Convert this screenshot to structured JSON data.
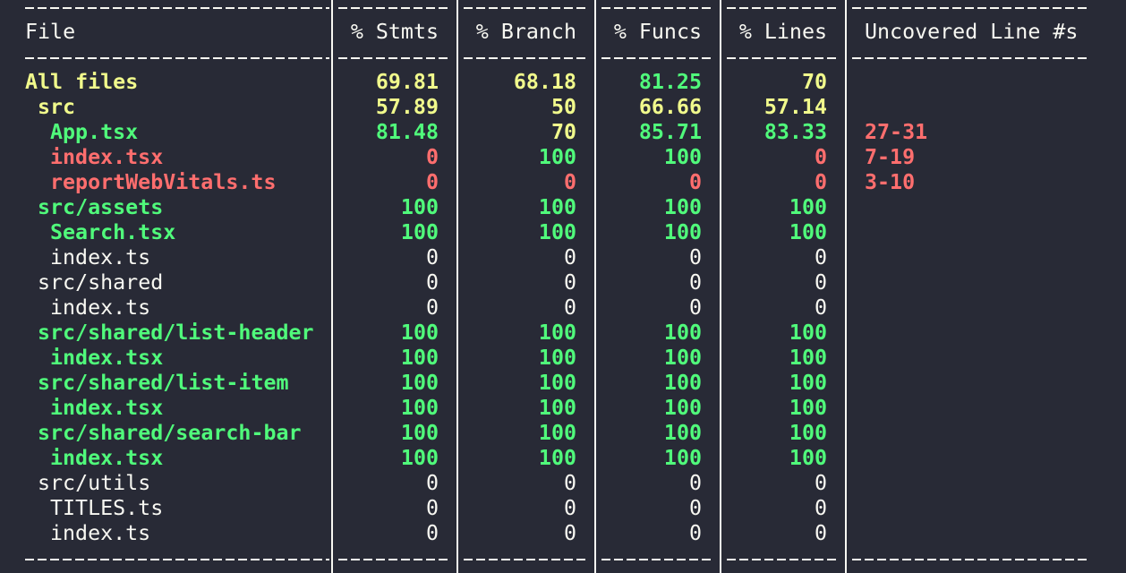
{
  "headers": {
    "file": "File",
    "stmts": "% Stmts",
    "branch": "% Branch",
    "funcs": "% Funcs",
    "lines": "% Lines",
    "uncovered": "Uncovered Line #s"
  },
  "colors": {
    "background": "#282a36",
    "foreground": "#f8f8f2",
    "yellow": "#f1fa8c",
    "green": "#50fa7b",
    "red": "#ff6e6e"
  },
  "rows": [
    {
      "file": "All files",
      "indent": 0,
      "color": "yellow",
      "bold": true,
      "stmts": "69.81",
      "stmts_color": "yellow",
      "branch": "68.18",
      "branch_color": "yellow",
      "funcs": "81.25",
      "funcs_color": "green",
      "lines": "70",
      "lines_color": "yellow",
      "uncovered": ""
    },
    {
      "file": "src",
      "indent": 1,
      "color": "yellow",
      "bold": true,
      "stmts": "57.89",
      "stmts_color": "yellow",
      "branch": "50",
      "branch_color": "yellow",
      "funcs": "66.66",
      "funcs_color": "yellow",
      "lines": "57.14",
      "lines_color": "yellow",
      "uncovered": ""
    },
    {
      "file": "App.tsx",
      "indent": 2,
      "color": "green",
      "bold": true,
      "stmts": "81.48",
      "stmts_color": "green",
      "branch": "70",
      "branch_color": "yellow",
      "funcs": "85.71",
      "funcs_color": "green",
      "lines": "83.33",
      "lines_color": "green",
      "uncovered": "27-31"
    },
    {
      "file": "index.tsx",
      "indent": 2,
      "color": "red",
      "bold": true,
      "stmts": "0",
      "stmts_color": "red",
      "branch": "100",
      "branch_color": "green",
      "funcs": "100",
      "funcs_color": "green",
      "lines": "0",
      "lines_color": "red",
      "uncovered": "7-19"
    },
    {
      "file": "reportWebVitals.ts",
      "indent": 2,
      "color": "red",
      "bold": true,
      "stmts": "0",
      "stmts_color": "red",
      "branch": "0",
      "branch_color": "red",
      "funcs": "0",
      "funcs_color": "red",
      "lines": "0",
      "lines_color": "red",
      "uncovered": "3-10"
    },
    {
      "file": "src/assets",
      "indent": 1,
      "color": "green",
      "bold": true,
      "stmts": "100",
      "stmts_color": "green",
      "branch": "100",
      "branch_color": "green",
      "funcs": "100",
      "funcs_color": "green",
      "lines": "100",
      "lines_color": "green",
      "uncovered": ""
    },
    {
      "file": "Search.tsx",
      "indent": 2,
      "color": "green",
      "bold": true,
      "stmts": "100",
      "stmts_color": "green",
      "branch": "100",
      "branch_color": "green",
      "funcs": "100",
      "funcs_color": "green",
      "lines": "100",
      "lines_color": "green",
      "uncovered": ""
    },
    {
      "file": "index.ts",
      "indent": 2,
      "color": "white",
      "bold": false,
      "stmts": "0",
      "stmts_color": "white",
      "branch": "0",
      "branch_color": "white",
      "funcs": "0",
      "funcs_color": "white",
      "lines": "0",
      "lines_color": "white",
      "uncovered": ""
    },
    {
      "file": "src/shared",
      "indent": 1,
      "color": "white",
      "bold": false,
      "stmts": "0",
      "stmts_color": "white",
      "branch": "0",
      "branch_color": "white",
      "funcs": "0",
      "funcs_color": "white",
      "lines": "0",
      "lines_color": "white",
      "uncovered": ""
    },
    {
      "file": "index.ts",
      "indent": 2,
      "color": "white",
      "bold": false,
      "stmts": "0",
      "stmts_color": "white",
      "branch": "0",
      "branch_color": "white",
      "funcs": "0",
      "funcs_color": "white",
      "lines": "0",
      "lines_color": "white",
      "uncovered": ""
    },
    {
      "file": "src/shared/list-header",
      "indent": 1,
      "color": "green",
      "bold": true,
      "stmts": "100",
      "stmts_color": "green",
      "branch": "100",
      "branch_color": "green",
      "funcs": "100",
      "funcs_color": "green",
      "lines": "100",
      "lines_color": "green",
      "uncovered": ""
    },
    {
      "file": "index.tsx",
      "indent": 2,
      "color": "green",
      "bold": true,
      "stmts": "100",
      "stmts_color": "green",
      "branch": "100",
      "branch_color": "green",
      "funcs": "100",
      "funcs_color": "green",
      "lines": "100",
      "lines_color": "green",
      "uncovered": ""
    },
    {
      "file": "src/shared/list-item",
      "indent": 1,
      "color": "green",
      "bold": true,
      "stmts": "100",
      "stmts_color": "green",
      "branch": "100",
      "branch_color": "green",
      "funcs": "100",
      "funcs_color": "green",
      "lines": "100",
      "lines_color": "green",
      "uncovered": ""
    },
    {
      "file": "index.tsx",
      "indent": 2,
      "color": "green",
      "bold": true,
      "stmts": "100",
      "stmts_color": "green",
      "branch": "100",
      "branch_color": "green",
      "funcs": "100",
      "funcs_color": "green",
      "lines": "100",
      "lines_color": "green",
      "uncovered": ""
    },
    {
      "file": "src/shared/search-bar",
      "indent": 1,
      "color": "green",
      "bold": true,
      "stmts": "100",
      "stmts_color": "green",
      "branch": "100",
      "branch_color": "green",
      "funcs": "100",
      "funcs_color": "green",
      "lines": "100",
      "lines_color": "green",
      "uncovered": ""
    },
    {
      "file": "index.tsx",
      "indent": 2,
      "color": "green",
      "bold": true,
      "stmts": "100",
      "stmts_color": "green",
      "branch": "100",
      "branch_color": "green",
      "funcs": "100",
      "funcs_color": "green",
      "lines": "100",
      "lines_color": "green",
      "uncovered": ""
    },
    {
      "file": "src/utils",
      "indent": 1,
      "color": "white",
      "bold": false,
      "stmts": "0",
      "stmts_color": "white",
      "branch": "0",
      "branch_color": "white",
      "funcs": "0",
      "funcs_color": "white",
      "lines": "0",
      "lines_color": "white",
      "uncovered": ""
    },
    {
      "file": "TITLES.ts",
      "indent": 2,
      "color": "white",
      "bold": false,
      "stmts": "0",
      "stmts_color": "white",
      "branch": "0",
      "branch_color": "white",
      "funcs": "0",
      "funcs_color": "white",
      "lines": "0",
      "lines_color": "white",
      "uncovered": ""
    },
    {
      "file": "index.ts",
      "indent": 2,
      "color": "white",
      "bold": false,
      "stmts": "0",
      "stmts_color": "white",
      "branch": "0",
      "branch_color": "white",
      "funcs": "0",
      "funcs_color": "white",
      "lines": "0",
      "lines_color": "white",
      "uncovered": ""
    }
  ]
}
